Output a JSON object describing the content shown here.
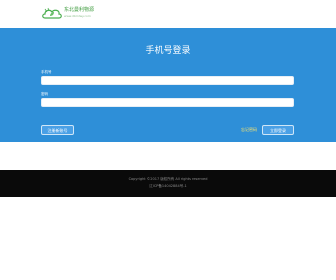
{
  "header": {
    "logo_title": "东北曼利物源",
    "logo_subtitle": "www.dbmlwy.com",
    "logo_icon": "cloud-leaf-icon"
  },
  "login": {
    "title": "手机号登录",
    "phone_label": "手机号",
    "phone_value": "",
    "phone_placeholder": "",
    "password_label": "密码",
    "password_value": "",
    "password_placeholder": "",
    "register_button": "注册新账号",
    "forgot_link": "忘记密码",
    "login_button": "立即登录"
  },
  "footer": {
    "copyright": "Copyright ©2017 版权所有 All rights reserved",
    "icp": "辽ICP备14042884号-1"
  },
  "colors": {
    "brand_blue": "#2e8fd8",
    "button_blue": "#4aa0e6",
    "link_yellow": "#ffe66b",
    "footer_bg": "#0a0a0a",
    "logo_green": "#3a9a3a"
  }
}
